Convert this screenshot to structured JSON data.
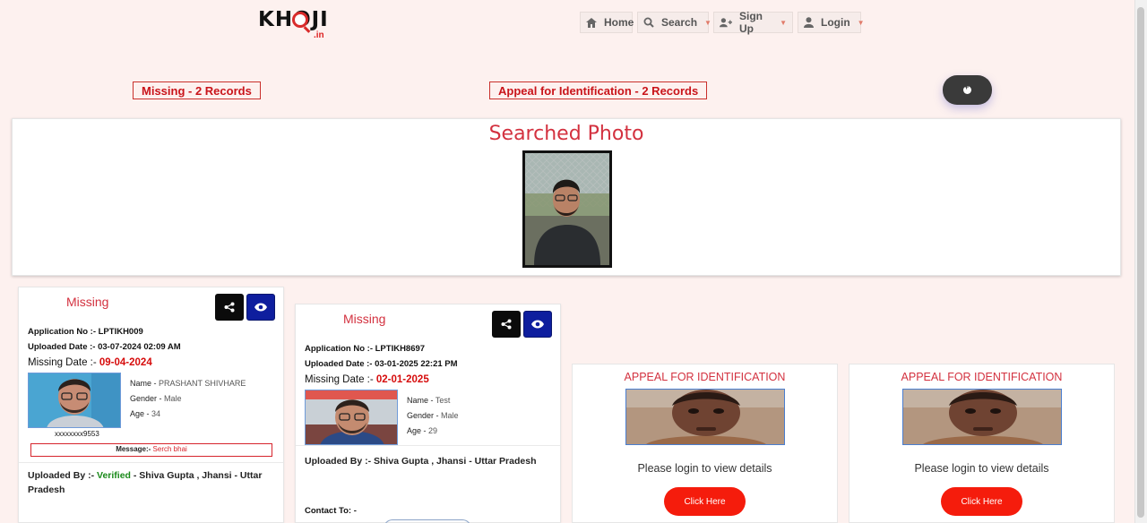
{
  "header": {
    "logo_text": "KHOJI",
    "logo_tld": ".in",
    "nav": [
      {
        "label": "Home",
        "icon": "home-icon"
      },
      {
        "label": "Search",
        "icon": "search-icon"
      },
      {
        "label": "Sign Up",
        "icon": "user-plus-icon"
      },
      {
        "label": "Login",
        "icon": "user-icon"
      }
    ]
  },
  "records": {
    "missing_label": "Missing - 2 Records",
    "appeal_label": "Appeal for Identification - 2 Records"
  },
  "searched": {
    "title": "Searched Photo"
  },
  "cards": [
    {
      "status": "Missing",
      "application": "Application No :- LPTIKH009",
      "uploaded_date": "Uploaded Date :- 03-07-2024 02:09 AM",
      "missing_date_label": "Missing Date :- ",
      "missing_date": "09-04-2024",
      "name_label": "Name",
      "name": "PRASHANT SHIVHARE",
      "gender_label": "Gender",
      "gender": "Male",
      "age_label": "Age",
      "age": "34",
      "phone": "xxxxxxxx9553",
      "message_label": "Message:-",
      "message": "Serch bhai",
      "uploaded_by_label": "Uploaded By :-",
      "verified": "Verified",
      "uploaded_by": "Shiva Gupta , Jhansi - Uttar Pradesh"
    },
    {
      "status": "Missing",
      "application": "Application No :- LPTIKH8697",
      "uploaded_date": "Uploaded Date :- 03-01-2025 22:21 PM",
      "missing_date_label": "Missing Date :- ",
      "missing_date": "02-01-2025",
      "name_label": "Name",
      "name": "Test",
      "gender_label": "Gender",
      "gender": "Male",
      "age_label": "Age",
      "age": "29",
      "uploaded_by_label": "Uploaded By :-",
      "uploaded_by": "Shiva Gupta , Jhansi - Uttar Pradesh",
      "contact_label": "Contact To: -"
    }
  ],
  "appeals": [
    {
      "title": "APPEAL FOR IDENTIFICATION",
      "login_text": "Please login to view details",
      "button": "Click Here"
    },
    {
      "title": "APPEAL FOR IDENTIFICATION",
      "login_text": "Please login to view details",
      "button": "Click Here"
    }
  ],
  "colors": {
    "background": "#fdf1ef",
    "accent_red": "#d3313f",
    "button_blue": "#0e1e9e",
    "click_red": "#f51c0c",
    "verified_green": "#1a8a1a"
  }
}
